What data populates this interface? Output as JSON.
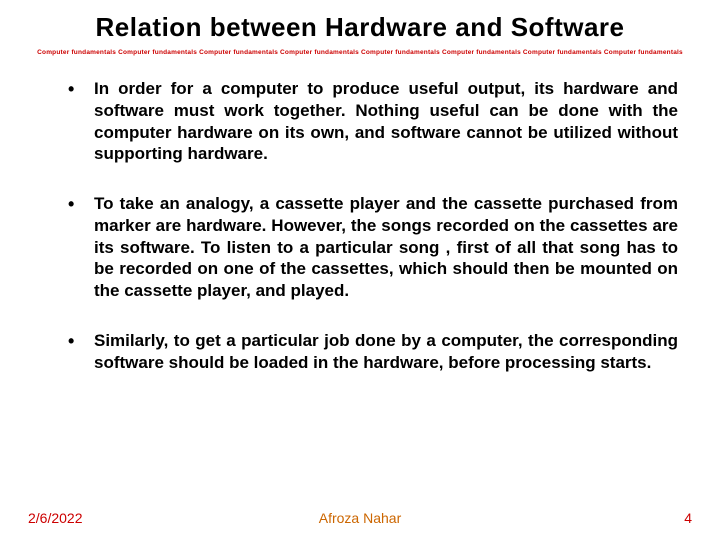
{
  "title": "Relation between Hardware and Software",
  "divider": "Computer fundamentals Computer fundamentals Computer fundamentals Computer fundamentals Computer fundamentals Computer fundamentals Computer fundamentals Computer fundamentals",
  "bullets": [
    "In order for a computer to produce useful output, its hardware and software must work together. Nothing useful can be done with the computer hardware on its own, and software cannot be utilized without supporting hardware.",
    "To take an analogy, a cassette player and the cassette purchased from marker are hardware. However, the songs recorded on the cassettes are its software. To listen to a particular song , first of all that song has to be recorded on one of the cassettes, which should then be mounted on the cassette player, and played.",
    " Similarly, to get a particular job done by a computer, the corresponding software should be loaded in the hardware, before processing starts."
  ],
  "footer": {
    "date": "2/6/2022",
    "author": "Afroza Nahar",
    "page": "4"
  }
}
